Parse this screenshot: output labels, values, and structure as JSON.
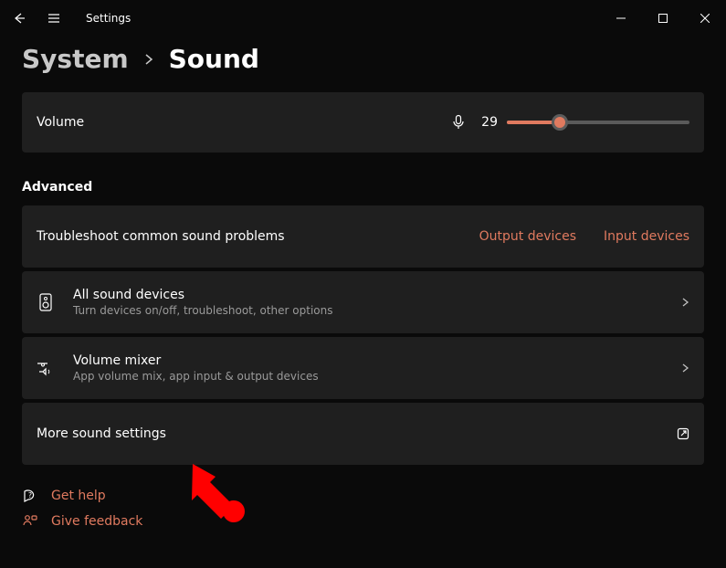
{
  "window": {
    "title": "Settings"
  },
  "breadcrumb": {
    "parent": "System",
    "current": "Sound"
  },
  "volume": {
    "label": "Volume",
    "value": "29",
    "percent": 29,
    "accent": "#e07a5f"
  },
  "advanced": {
    "heading": "Advanced"
  },
  "troubleshoot": {
    "label": "Troubleshoot common sound problems",
    "output_link": "Output devices",
    "input_link": "Input devices"
  },
  "all_sound": {
    "title": "All sound devices",
    "sub": "Turn devices on/off, troubleshoot, other options"
  },
  "mixer": {
    "title": "Volume mixer",
    "sub": "App volume mix, app input & output devices"
  },
  "more": {
    "title": "More sound settings"
  },
  "footer": {
    "help": "Get help",
    "feedback": "Give feedback"
  }
}
